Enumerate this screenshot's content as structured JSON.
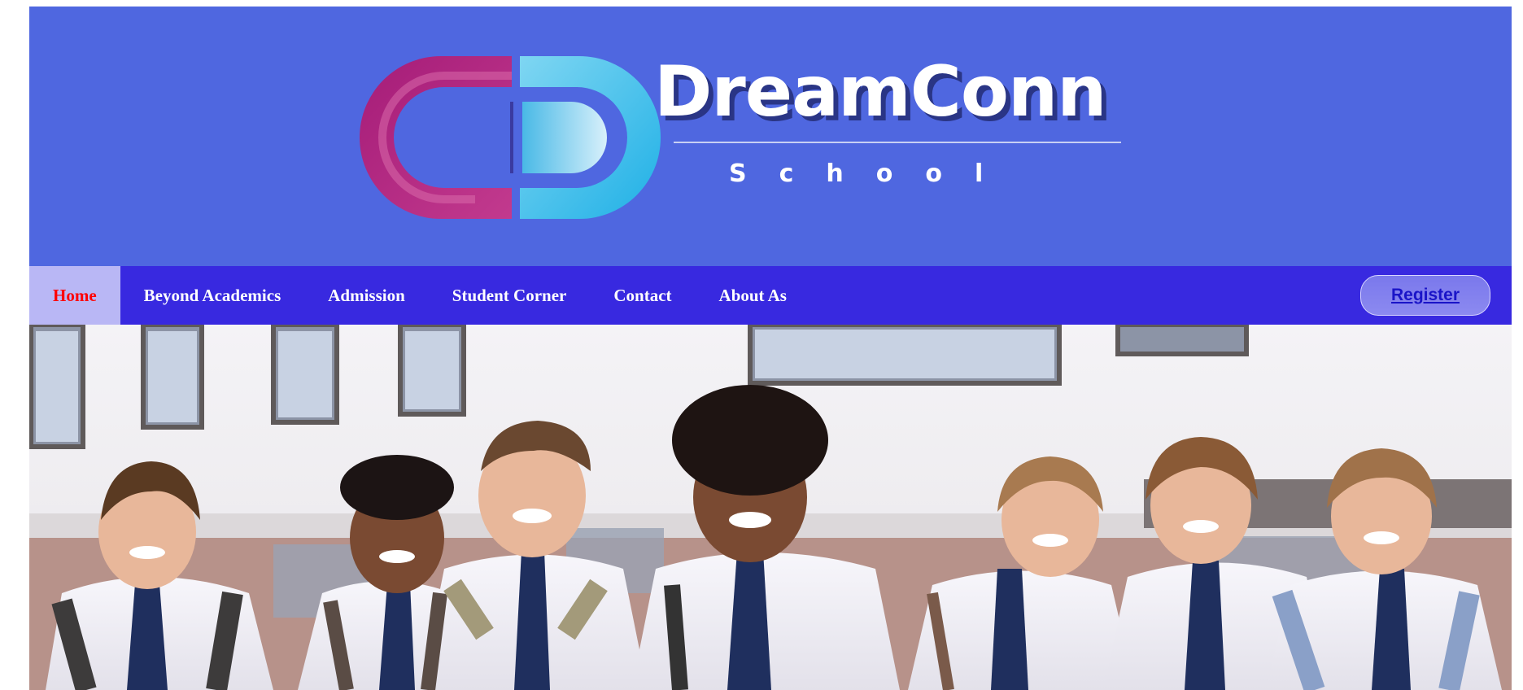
{
  "header": {
    "brand_name": "DreamConn",
    "brand_subtitle": "School",
    "logo": "dreamconn-cd-logo"
  },
  "nav": {
    "items": [
      {
        "label": "Home",
        "active": true
      },
      {
        "label": "Beyond Academics",
        "active": false
      },
      {
        "label": "Admission",
        "active": false
      },
      {
        "label": "Student Corner",
        "active": false
      },
      {
        "label": "Contact",
        "active": false
      },
      {
        "label": "About As",
        "active": false
      }
    ],
    "register_label": "Register"
  },
  "hero": {
    "image": "group-of-smiling-school-children-in-uniform-outside-school-building"
  },
  "colors": {
    "banner_bg": "#4f67e0",
    "nav_bg": "#3829e0",
    "nav_active_bg": "#b9b7f5",
    "nav_active_text": "#ff0000",
    "nav_text": "#ffffff",
    "logo_magenta": "#b0287f",
    "logo_cyan": "#52c4ec"
  }
}
